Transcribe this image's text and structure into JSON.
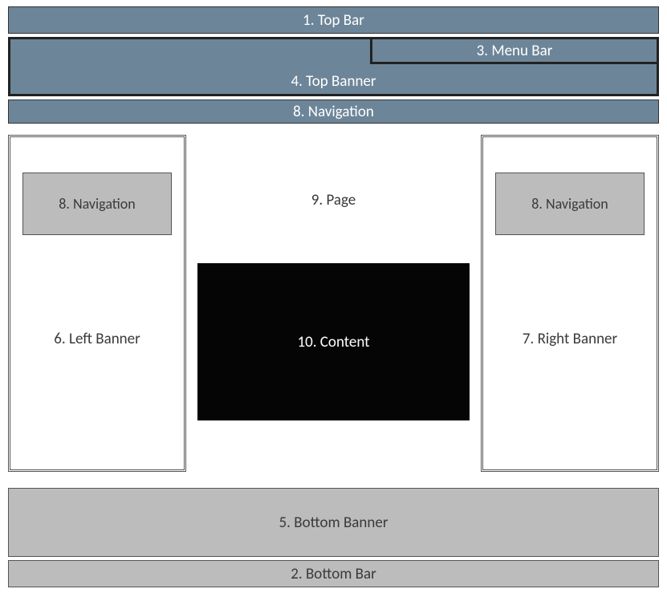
{
  "layout": {
    "top_bar": "1. Top Bar",
    "menu_bar": "3. Menu Bar",
    "top_banner": "4. Top Banner",
    "navigation": "8. Navigation",
    "left_banner": "6. Left Banner",
    "right_banner": "7. Right Banner",
    "page": "9. Page",
    "content": "10. Content",
    "bottom_banner": "5. Bottom Banner",
    "bottom_bar": "2. Bottom Bar"
  },
  "colors": {
    "steel": "#6d8598",
    "gray": "#bcbcbc",
    "black": "#050505"
  }
}
